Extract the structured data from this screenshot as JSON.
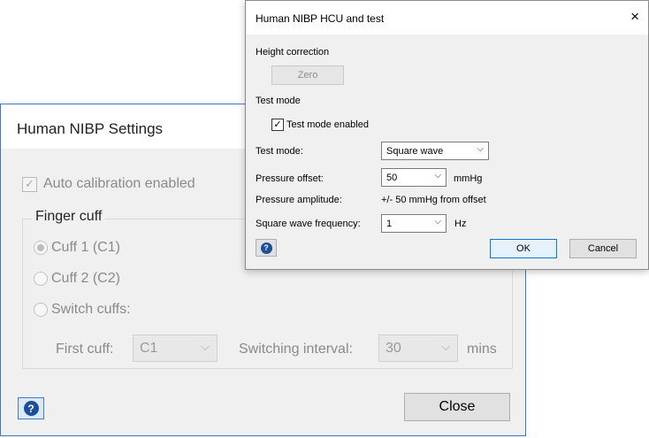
{
  "settings_dialog": {
    "title": "Human NIBP Settings",
    "auto_calibration_label": "Auto calibration enabled",
    "finger_cuff_group": "Finger cuff",
    "radio_cuff1": "Cuff 1 (C1)",
    "radio_cuff2": "Cuff 2 (C2)",
    "radio_switch": "Switch cuffs:",
    "first_cuff_label": "First cuff:",
    "first_cuff_value": "C1",
    "switching_interval_label": "Switching interval:",
    "switching_interval_value": "30",
    "switching_interval_unit": "mins",
    "close_label": "Close",
    "help_icon": "question-mark-icon"
  },
  "hcu_dialog": {
    "title": "Human NIBP HCU and test",
    "close_icon": "×",
    "height_correction_label": "Height correction",
    "zero_label": "Zero",
    "test_mode_section": "Test mode",
    "test_mode_enabled_label": "Test mode enabled",
    "test_mode_enabled_checked": "✓",
    "test_mode_label": "Test mode:",
    "test_mode_value": "Square wave",
    "pressure_offset_label": "Pressure offset:",
    "pressure_offset_value": "50",
    "pressure_offset_unit": "mmHg",
    "pressure_amplitude_label": "Pressure amplitude:",
    "pressure_amplitude_value": "+/- 50 mmHg from offset",
    "square_wave_freq_label": "Square wave frequency:",
    "square_wave_freq_value": "1",
    "square_wave_freq_unit": "Hz",
    "ok_label": "OK",
    "cancel_label": "Cancel"
  },
  "glyphs": {
    "chevron": "⌵",
    "check": "✓",
    "question": "?"
  }
}
